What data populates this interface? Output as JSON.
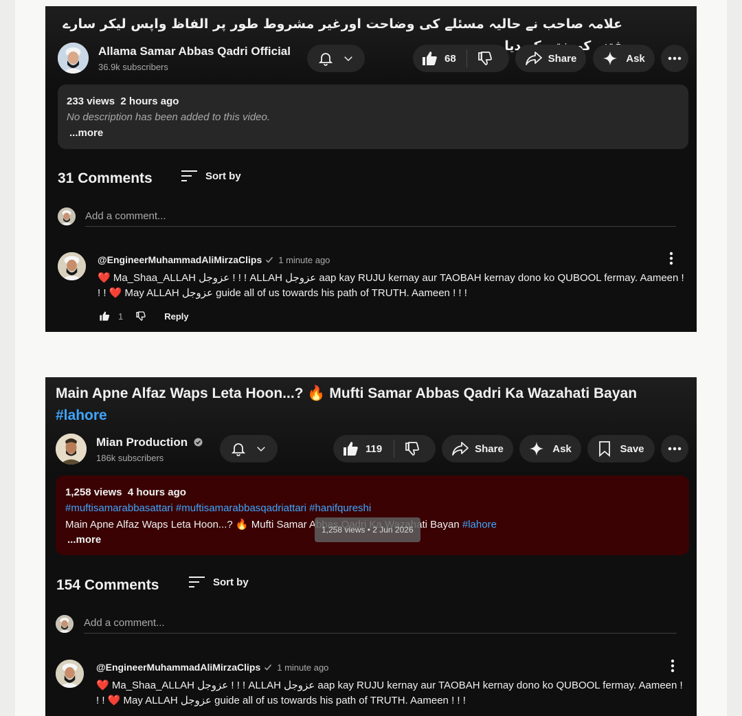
{
  "video1": {
    "title": "علامہ صاحب نے حالیہ مسئلے کی وضاحت اورغیر مشروط طور پر الفاظ واپس لیکر سارے فتنے کو ختم کر دیا",
    "channel": {
      "name": "Allama Samar Abbas Qadri Official",
      "subscribers": "36.9k subscribers"
    },
    "likes": "68",
    "share_label": "Share",
    "ask_label": "Ask",
    "description": {
      "views": "233 views",
      "time": "2 hours ago",
      "text": "No description has been added to this video.",
      "more": "...more"
    },
    "comments_count": "31 Comments",
    "sort_label": "Sort by",
    "add_comment_placeholder": "Add a comment...",
    "comment": {
      "author": "@EngineerMuhammadAliMirzaClips",
      "time": "1 minute ago",
      "line1": "❤️ Ma_Shaa_ALLAH عزوجل ! ! !  ALLAH عزوجل aap kay RUJU kernay aur TAOBAH kernay dono ko QUBOOL fermay. Aameen !",
      "line2": "! ! ❤️ May ALLAH عزوجل guide all of us towards his path of TRUTH. Aameen ! ! !",
      "likes": "1",
      "reply_label": "Reply"
    }
  },
  "video2": {
    "title_main": "Main Apne Alfaz Waps Leta Hoon...? 🔥 Mufti Samar Abbas Qadri Ka Wazahati Bayan",
    "title_hashtag": "#lahore",
    "channel": {
      "name": "Mian Production",
      "subscribers": "186k subscribers"
    },
    "likes": "119",
    "share_label": "Share",
    "ask_label": "Ask",
    "save_label": "Save",
    "description": {
      "views": "1,258 views",
      "time": "4 hours ago",
      "hashtags": "#muftisamarabbasattari #muftisamarabbasqadriattari #hanifqureshi",
      "text": "Main Apne Alfaz Waps Leta Hoon...? 🔥 Mufti Samar Abbas Qadri Ka Wazahati Bayan",
      "text_hashtag": "#lahore",
      "more": "...more"
    },
    "tooltip": "1,258 views • 2 Jun 2026",
    "comments_count": "154 Comments",
    "sort_label": "Sort by",
    "add_comment_placeholder": "Add a comment...",
    "comment": {
      "author": "@EngineerMuhammadAliMirzaClips",
      "time": "1 minute ago",
      "line1": "❤️ Ma_Shaa_ALLAH عزوجل ! ! !  ALLAH عزوجل aap kay RUJU kernay aur TAOBAH kernay dono ko QUBOOL fermay. Aameen !",
      "line2": "! ! ❤️ May ALLAH عزوجل guide all of us towards his path of TRUTH. Aameen ! ! !"
    }
  },
  "colors": {
    "card_bg": "#0f0f0f",
    "pill_bg": "#272727",
    "desc_bg_2": "#3a0203",
    "link": "#3ea6ff",
    "page_bg": "#f8f8f6"
  }
}
